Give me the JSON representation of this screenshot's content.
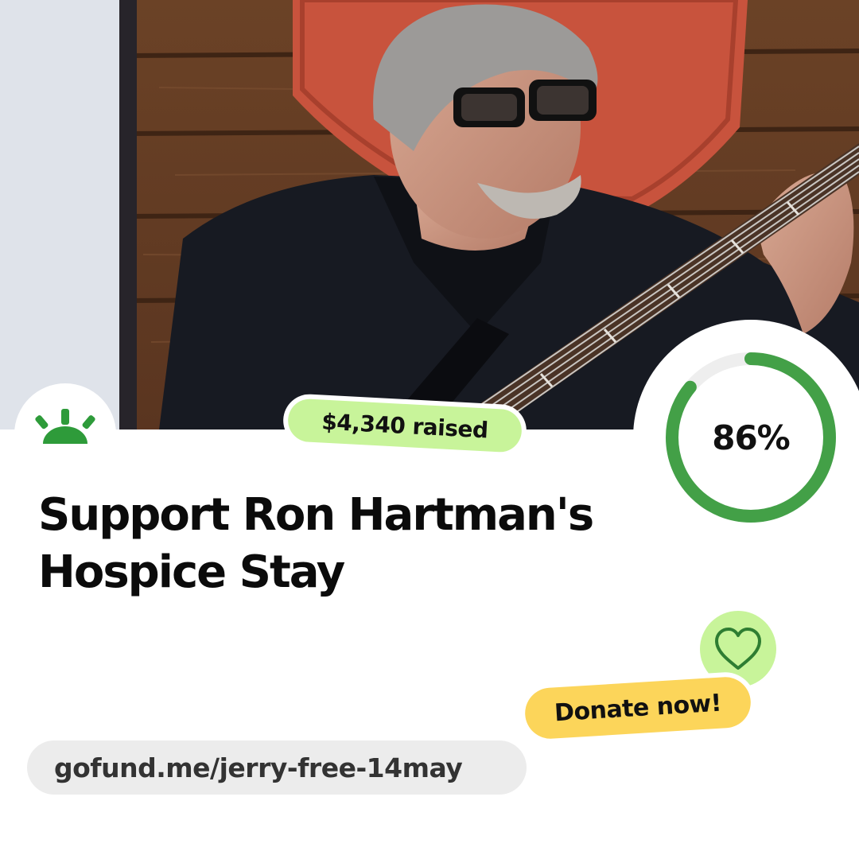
{
  "photo": {
    "alt": "Man with glasses playing a bass guitar in front of a wooden wall"
  },
  "logo": {
    "icon": "gofundme-sun-icon",
    "color": "#2e9b3a"
  },
  "raised": {
    "label": "$4,340 raised",
    "bg": "#c8f49a"
  },
  "progress": {
    "label": "86%",
    "value": 0.86,
    "color": "#43a047",
    "track": "#eeeeee"
  },
  "campaign": {
    "title": "Support Ron Hartman's Hospice Stay"
  },
  "heart": {
    "icon": "heart-icon",
    "bg": "#c8f49a",
    "stroke": "#2e7d32"
  },
  "donate": {
    "label": "Donate now!",
    "bg": "#fcd55a"
  },
  "link": {
    "url": "gofund.me/jerry-free-14may"
  }
}
